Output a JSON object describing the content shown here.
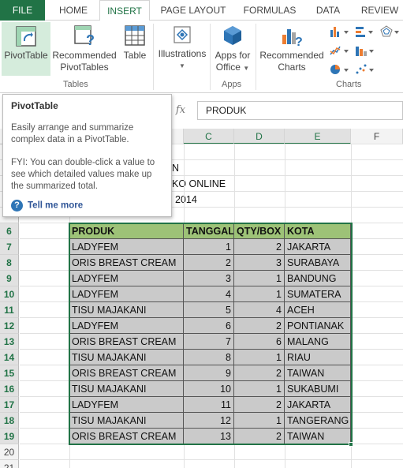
{
  "ribbon_tabs": [
    "FILE",
    "HOME",
    "INSERT",
    "PAGE LAYOUT",
    "FORMULAS",
    "DATA",
    "REVIEW"
  ],
  "active_tab": "INSERT",
  "ribbon": {
    "pivottable": "PivotTable",
    "recommended_pivottables_line1": "Recommended",
    "recommended_pivottables_line2": "PivotTables",
    "table": "Table",
    "tables_group": "Tables",
    "illustrations": "Illustrations",
    "apps_for_office_line1": "Apps for",
    "apps_for_office_line2": "Office",
    "apps_group": "Apps",
    "recommended_charts_line1": "Recommended",
    "recommended_charts_line2": "Charts",
    "charts_group": "Charts"
  },
  "formula_bar": {
    "fx": "fx",
    "value": "PRODUK"
  },
  "tooltip": {
    "title": "PivotTable",
    "body1": "Easily arrange and summarize complex data in a PivotTable.",
    "body2": "FYI: You can double-click a value to see which detailed values make up the summarized total.",
    "help": "?",
    "link": "Tell me more"
  },
  "columns": [
    "C",
    "D",
    "E",
    "F"
  ],
  "upper_rows": [
    {
      "row": "3",
      "text": "N"
    },
    {
      "row": "4",
      "text": "KO ONLINE"
    },
    {
      "row": "5",
      "text": "2014"
    }
  ],
  "row_numbers": [
    "6",
    "7",
    "8",
    "9",
    "10",
    "11",
    "12",
    "13",
    "14",
    "15",
    "16",
    "17",
    "18",
    "19",
    "20",
    "21"
  ],
  "table": {
    "headers": [
      "PRODUK",
      "TANGGAL",
      "QTY/BOX",
      "KOTA"
    ],
    "rows": [
      [
        "LADYFEM",
        "1",
        "2",
        "JAKARTA"
      ],
      [
        "ORIS BREAST CREAM",
        "2",
        "3",
        "SURABAYA"
      ],
      [
        "LADYFEM",
        "3",
        "1",
        "BANDUNG"
      ],
      [
        "LADYFEM",
        "4",
        "1",
        "SUMATERA"
      ],
      [
        "TISU MAJAKANI",
        "5",
        "4",
        "ACEH"
      ],
      [
        "LADYFEM",
        "6",
        "2",
        "PONTIANAK"
      ],
      [
        "ORIS BREAST CREAM",
        "7",
        "6",
        "MALANG"
      ],
      [
        "TISU MAJAKANI",
        "8",
        "1",
        "RIAU"
      ],
      [
        "ORIS BREAST CREAM",
        "9",
        "2",
        "TAIWAN"
      ],
      [
        "TISU MAJAKANI",
        "10",
        "1",
        "SUKABUMI"
      ],
      [
        "LADYFEM",
        "11",
        "2",
        "JAKARTA"
      ],
      [
        "TISU MAJAKANI",
        "12",
        "1",
        "TANGERANG"
      ],
      [
        "ORIS BREAST CREAM",
        "13",
        "2",
        "TAIWAN"
      ]
    ]
  },
  "colors": {
    "accent": "#217346",
    "header_fill": "#9dc277",
    "data_fill": "#cacaca"
  }
}
